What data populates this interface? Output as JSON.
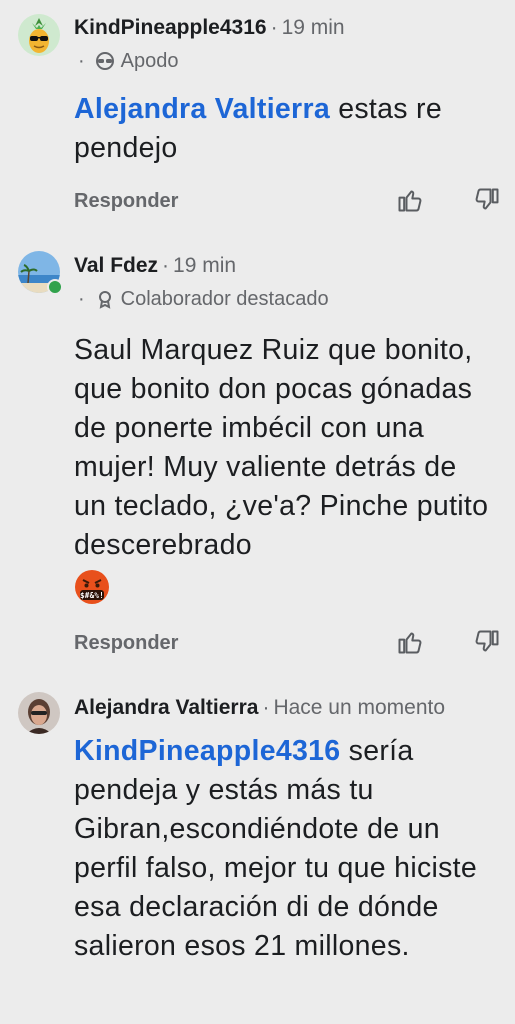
{
  "comments": [
    {
      "author": "KindPineapple4316",
      "separator": "·",
      "time": "19 min",
      "badge": "Apodo",
      "badge_dot": "·",
      "badge_icon": "sunglasses-mask-icon",
      "mention": "Alejandra Valtierra",
      "text": " estas re pendejo",
      "reply_label": "Responder"
    },
    {
      "author": "Val Fdez",
      "separator": "·",
      "time": "19 min",
      "badge": "Colaborador destacado",
      "badge_dot": "·",
      "badge_icon": "top-contributor-icon",
      "text": "Saul Marquez Ruiz que bonito, que bonito don pocas gónadas de ponerte imbécil con una mujer! Muy valiente detrás de un teclado, ¿ve'a? Pinche putito descerebrado",
      "emoji": "face-with-symbols-on-mouth",
      "reply_label": "Responder"
    },
    {
      "author": "Alejandra Valtierra",
      "separator": "·",
      "time": "Hace un momento",
      "mention": "KindPineapple4316",
      "text": " sería pendeja y estás más tu Gibran,escondiéndote de un perfil falso, mejor tu que hiciste esa declaración di de dónde salieron esos 21 millones."
    }
  ],
  "colors": {
    "background": "#ececec",
    "mention": "#1d66d6",
    "meta": "#65676b",
    "text": "#1c1e21",
    "online": "#31a24c"
  }
}
